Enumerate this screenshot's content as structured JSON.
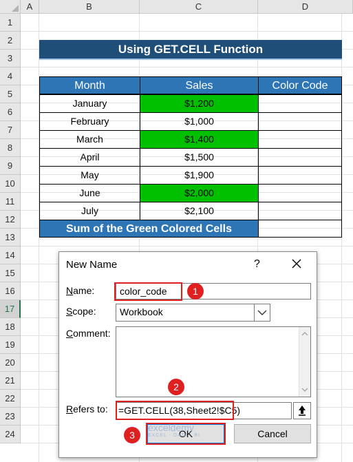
{
  "columns": [
    "A",
    "B",
    "C",
    "D"
  ],
  "rows": [
    "1",
    "2",
    "3",
    "4",
    "5",
    "6",
    "7",
    "8",
    "9",
    "10",
    "11",
    "12",
    "13",
    "14",
    "15",
    "16",
    "17",
    "18",
    "19",
    "20",
    "21",
    "22",
    "23",
    "24"
  ],
  "selected_row": "17",
  "sheet": {
    "title": "Using GET.CELL Function",
    "headers": [
      "Month",
      "Sales",
      "Color Code"
    ],
    "data": [
      {
        "month": "January",
        "sales": "$1,200",
        "green": true
      },
      {
        "month": "February",
        "sales": "$1,000",
        "green": false
      },
      {
        "month": "March",
        "sales": "$1,400",
        "green": true
      },
      {
        "month": "April",
        "sales": "$1,500",
        "green": false
      },
      {
        "month": "May",
        "sales": "$1,900",
        "green": false
      },
      {
        "month": "June",
        "sales": "$2,000",
        "green": true
      },
      {
        "month": "July",
        "sales": "$2,100",
        "green": false
      }
    ],
    "sum_label": "Sum of the Green Colored Cells"
  },
  "dialog": {
    "title": "New Name",
    "help": "?",
    "name_label_u": "N",
    "name_label_rest": "ame:",
    "name_value": "color_code",
    "scope_label_u": "S",
    "scope_label_rest": "cope:",
    "scope_value": "Workbook",
    "comment_label_u": "C",
    "comment_label_rest": "omment:",
    "refers_label_u": "R",
    "refers_label_rest": "efers to:",
    "refers_value": "=GET.CELL(38,Sheet2!$C5)",
    "ok_label": "OK",
    "cancel_label": "Cancel"
  },
  "callouts": [
    "1",
    "2",
    "3"
  ],
  "watermark": {
    "name": "exceldemy",
    "tagline": "EXCEL · DATA · BI"
  },
  "colors": {
    "header_blue": "#2e75b6",
    "title_navy": "#1f4e79",
    "green_fill": "#00c000",
    "callout_red": "#e02020"
  }
}
